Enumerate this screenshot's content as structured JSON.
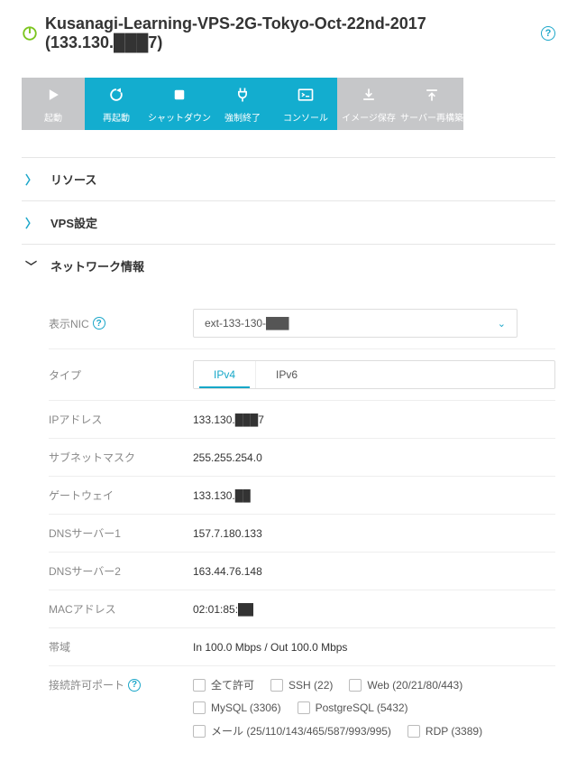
{
  "header": {
    "title": "Kusanagi-Learning-VPS-2G-Tokyo-Oct-22nd-2017 (133.130.███7)"
  },
  "toolbar": {
    "start": {
      "label": "起動"
    },
    "restart": {
      "label": "再起動"
    },
    "shutdown": {
      "label": "シャットダウン"
    },
    "force": {
      "label": "強制終了"
    },
    "console": {
      "label": "コンソール"
    },
    "snapshot": {
      "label": "イメージ保存"
    },
    "rebuild": {
      "label": "サーバー再構築"
    }
  },
  "accordion": {
    "resource": "リソース",
    "vps": "VPS設定",
    "network": "ネットワーク情報"
  },
  "network": {
    "nic_label": "表示NIC",
    "nic_value": "ext-133-130-███",
    "type_label": "タイプ",
    "type_tabs": {
      "ipv4": "IPv4",
      "ipv6": "IPv6",
      "active": "ipv4"
    },
    "ip_label": "IPアドレス",
    "ip_value": "133.130.███7",
    "subnet_label": "サブネットマスク",
    "subnet_value": "255.255.254.0",
    "gw_label": "ゲートウェイ",
    "gw_value": "133.130.██",
    "dns1_label": "DNSサーバー1",
    "dns1_value": "157.7.180.133",
    "dns2_label": "DNSサーバー2",
    "dns2_value": "163.44.76.148",
    "mac_label": "MACアドレス",
    "mac_value": "02:01:85:██",
    "bw_label": "帯域",
    "bw_value": "In 100.0 Mbps / Out 100.0 Mbps",
    "ports_label": "接続許可ポート",
    "ports": [
      "全て許可",
      "SSH (22)",
      "Web (20/21/80/443)",
      "MySQL (3306)",
      "PostgreSQL (5432)",
      "メール (25/110/143/465/587/993/995)",
      "RDP (3389)"
    ]
  }
}
